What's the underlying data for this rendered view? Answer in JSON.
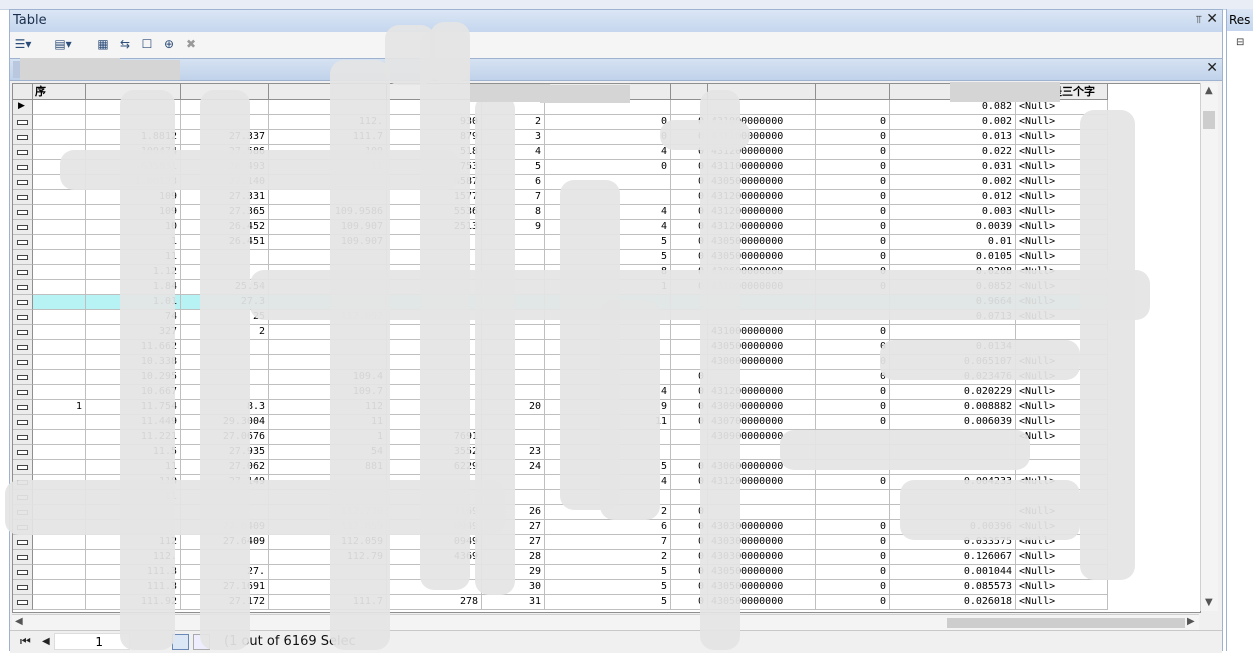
{
  "window": {
    "title": "Table",
    "pin_glyph": "⫪",
    "close_glyph": "✕"
  },
  "right_panel": {
    "title": "Res",
    "tree_toggle": "⊟"
  },
  "toolbar": {
    "icons": [
      "table-options-icon",
      "related-tables-icon",
      "select-by-attributes-icon",
      "switch-selection-icon",
      "clear-selection-icon",
      "zoom-to-selected-icon",
      "delete-selected-icon"
    ]
  },
  "grid": {
    "last_column_header": "不可能是三个字",
    "first_header_fragment": "序",
    "rows": [
      {
        "c1": "",
        "c2": "",
        "c3": "",
        "c4": "",
        "c5": "",
        "c6": "",
        "c7": "",
        "c8": "",
        "c9": "",
        "c10": "",
        "c11": "0.082",
        "c12": "<Null>"
      },
      {
        "c1": "",
        "c2": "",
        "c3": "",
        "c4": "112.",
        "c5": "930",
        "c6": "2",
        "c7": "0",
        "c8": "0",
        "c9": "431000000000",
        "c10": "0",
        "c11": "0.002",
        "c12": "<Null>"
      },
      {
        "c1": "",
        "c2": "1.8812",
        "c3": "27.337",
        "c4": "111.7",
        "c5": "879",
        "c6": "3",
        "c7": "0",
        "c8": "0",
        "c9": "431100000000",
        "c10": "0",
        "c11": "0.013",
        "c12": "<Null>"
      },
      {
        "c1": "",
        "c2": "109474",
        "c3": "27.586",
        "c4": "109",
        "c5": "518",
        "c6": "4",
        "c7": "4",
        "c8": "0",
        "c9": "431200000000",
        "c10": "0",
        "c11": "0.022",
        "c12": "<Null>"
      },
      {
        "c1": "",
        "c2": ".635831",
        "c3": "26.493",
        "c4": "11",
        "c5": "753",
        "c6": "5",
        "c7": "0",
        "c8": "0",
        "c9": "431100000000",
        "c10": "0",
        "c11": "0.031",
        "c12": "<Null>"
      },
      {
        "c1": "",
        "c2": "1.00123",
        "c3": "27.140",
        "c4": "",
        "c5": "0587",
        "c6": "6",
        "c7": "",
        "c8": "0",
        "c9": "430500000000",
        "c10": "0",
        "c11": "0.002",
        "c12": "<Null>"
      },
      {
        "c1": "",
        "c2": "109",
        "c3": "27.331",
        "c4": "",
        "c5": "1577",
        "c6": "7",
        "c7": "",
        "c8": "0",
        "c9": "431200000000",
        "c10": "0",
        "c11": "0.012",
        "c12": "<Null>"
      },
      {
        "c1": "",
        "c2": "109",
        "c3": "27.365",
        "c4": "109.9586",
        "c5": "5536",
        "c6": "8",
        "c7": "4",
        "c8": "0",
        "c9": "431200000000",
        "c10": "0",
        "c11": "0.003",
        "c12": "<Null>"
      },
      {
        "c1": "",
        "c2": "10",
        "c3": "26.452",
        "c4": "109.907",
        "c5": "2513",
        "c6": "9",
        "c7": "4",
        "c8": "0",
        "c9": "431200000000",
        "c10": "0",
        "c11": "0.0039",
        "c12": "<Null>"
      },
      {
        "c1": "",
        "c2": "1",
        "c3": "26.451",
        "c4": "109.907",
        "c5": "",
        "c6": "",
        "c7": "5",
        "c8": "0",
        "c9": "430500000000",
        "c10": "0",
        "c11": "0.01",
        "c12": "<Null>"
      },
      {
        "c1": "",
        "c2": "11",
        "c3": "",
        "c4": "",
        "c5": "",
        "c6": "",
        "c7": "5",
        "c8": "0",
        "c9": "430500000000",
        "c10": "0",
        "c11": "0.0105",
        "c12": "<Null>"
      },
      {
        "c1": "",
        "c2": "1.12",
        "c3": "",
        "c4": "",
        "c5": "",
        "c6": "",
        "c7": "8",
        "c8": "0",
        "c9": "430600000000",
        "c10": "0",
        "c11": "0.0208",
        "c12": "<Null>"
      },
      {
        "c1": "",
        "c2": "1.84",
        "c3": "25.54",
        "c4": "",
        "c5": "",
        "c6": "",
        "c7": "1",
        "c8": "0",
        "c9": "431000000000",
        "c10": "0",
        "c11": "0.0852",
        "c12": "<Null>"
      },
      {
        "c1": "",
        "c2": "1.01",
        "c3": "27.3",
        "c4": "",
        "c5": "",
        "c6": "",
        "c7": "",
        "c8": "",
        "c9": "",
        "c10": "",
        "c11": "0.9664",
        "c12": "<Null>",
        "hl": true
      },
      {
        "c1": "",
        "c2": "74",
        "c3": "25",
        "c4": "112.092",
        "c5": "",
        "c6": "",
        "c7": "",
        "c8": "",
        "c9": "",
        "c10": "",
        "c11": "0.0713",
        "c12": "<Null>"
      },
      {
        "c1": "",
        "c2": "327",
        "c3": "2",
        "c4": "",
        "c5": "",
        "c6": "",
        "c7": "",
        "c8": "",
        "c9": "431000000000",
        "c10": "0",
        "c11": "",
        "c12": ""
      },
      {
        "c1": "",
        "c2": "11.662",
        "c3": "",
        "c4": "",
        "c5": "",
        "c6": "",
        "c7": "",
        "c8": "",
        "c9": "430500000000",
        "c10": "0",
        "c11": "0.0134",
        "c12": ""
      },
      {
        "c1": "",
        "c2": "10.338",
        "c3": "",
        "c4": "",
        "c5": "",
        "c6": "",
        "c7": "",
        "c8": "",
        "c9": "430000000000",
        "c10": "0",
        "c11": "0.065107",
        "c12": "<Null>"
      },
      {
        "c1": "",
        "c2": "10.295",
        "c3": "",
        "c4": "109.4",
        "c5": "",
        "c6": "",
        "c7": "",
        "c8": "0",
        "c9": "",
        "c10": "0",
        "c11": "0.023476",
        "c12": "<Null>"
      },
      {
        "c1": "",
        "c2": "10.667",
        "c3": "",
        "c4": "109.7",
        "c5": "",
        "c6": "",
        "c7": "4",
        "c8": "0",
        "c9": "431200000000",
        "c10": "0",
        "c11": "0.020229",
        "c12": "<Null>"
      },
      {
        "c1": "1",
        "c2": "11.754",
        "c3": "8.3",
        "c4": "112",
        "c5": "",
        "c6": "20",
        "c7": "9",
        "c8": "0",
        "c9": "430900000000",
        "c10": "0",
        "c11": "0.008882",
        "c12": "<Null>"
      },
      {
        "c1": "",
        "c2": "11.449",
        "c3": "29.3004",
        "c4": "11",
        "c5": "",
        "c6": "",
        "c7": "11",
        "c8": "0",
        "c9": "430700000000",
        "c10": "0",
        "c11": "0.006039",
        "c12": "<Null>"
      },
      {
        "c1": "",
        "c2": "11.221",
        "c3": "27.0676",
        "c4": "1",
        "c5": "7691",
        "c6": "",
        "c7": "",
        "c8": "",
        "c9": "430900000000",
        "c10": "",
        "c11": "",
        "c12": "<Null>"
      },
      {
        "c1": "",
        "c2": "11.5",
        "c3": "27.935",
        "c4": "54",
        "c5": "3552",
        "c6": "23",
        "c7": "",
        "c8": "",
        "c9": "",
        "c10": "",
        "c11": "",
        "c12": ""
      },
      {
        "c1": "",
        "c2": "11",
        "c3": "27.062",
        "c4": "881",
        "c5": "6229",
        "c6": "24",
        "c7": "5",
        "c8": "0",
        "c9": "430600000000",
        "c10": "",
        "c11": "",
        "c12": ""
      },
      {
        "c1": "",
        "c2": "110",
        "c3": "27.149",
        "c4": "",
        "c5": "",
        "c6": "",
        "c7": "4",
        "c8": "0",
        "c9": "431200000000",
        "c10": "0",
        "c11": "0.004233",
        "c12": "<Null>"
      },
      {
        "c1": "",
        "c2": "11",
        "c3": "",
        "c4": "",
        "c5": "",
        "c6": "",
        "c7": "",
        "c8": "",
        "c9": "",
        "c10": "",
        "c11": "",
        "c12": ""
      },
      {
        "c1": "",
        "c2": "",
        "c3": "",
        "c4": "112.730",
        "c5": "7169",
        "c6": "26",
        "c7": "2",
        "c8": "0",
        "c9": "",
        "c10": "",
        "c11": "",
        "c12": "<Null>"
      },
      {
        "c1": "",
        "c2": "",
        "c3": "27.6409",
        "c4": "112.059",
        "c5": "0949",
        "c6": "27",
        "c7": "6",
        "c8": "0",
        "c9": "430300000000",
        "c10": "0",
        "c11": "0.00396",
        "c12": "<Null>"
      },
      {
        "c1": "",
        "c2": "112",
        "c3": "27.6409",
        "c4": "112.059",
        "c5": "0949",
        "c6": "27",
        "c7": "7",
        "c8": "0",
        "c9": "430300000000",
        "c10": "0",
        "c11": "0.033575",
        "c12": "<Null>"
      },
      {
        "c1": "",
        "c2": "112.",
        "c3": "",
        "c4": "112.79",
        "c5": "4369",
        "c6": "28",
        "c7": "2",
        "c8": "0",
        "c9": "430300000000",
        "c10": "0",
        "c11": "0.126067",
        "c12": "<Null>"
      },
      {
        "c1": "",
        "c2": "111.3",
        "c3": "27.",
        "c4": "",
        "c5": "",
        "c6": "29",
        "c7": "5",
        "c8": "0",
        "c9": "430500000000",
        "c10": "0",
        "c11": "0.001044",
        "c12": "<Null>"
      },
      {
        "c1": "",
        "c2": "111.3",
        "c3": "27.1691",
        "c4": "",
        "c5": "",
        "c6": "30",
        "c7": "5",
        "c8": "0",
        "c9": "430500000000",
        "c10": "0",
        "c11": "0.085573",
        "c12": "<Null>"
      },
      {
        "c1": "",
        "c2": "111.92",
        "c3": "27.172",
        "c4": "111.7",
        "c5": "278",
        "c6": "31",
        "c7": "5",
        "c8": "0",
        "c9": "430500000000",
        "c10": "0",
        "c11": "0.026018",
        "c12": "<Null>"
      }
    ]
  },
  "status": {
    "first_glyph": "⏮",
    "prev_glyph": "◀",
    "current_page": "1",
    "selection_text": "(1 out of 6169 Selec"
  }
}
